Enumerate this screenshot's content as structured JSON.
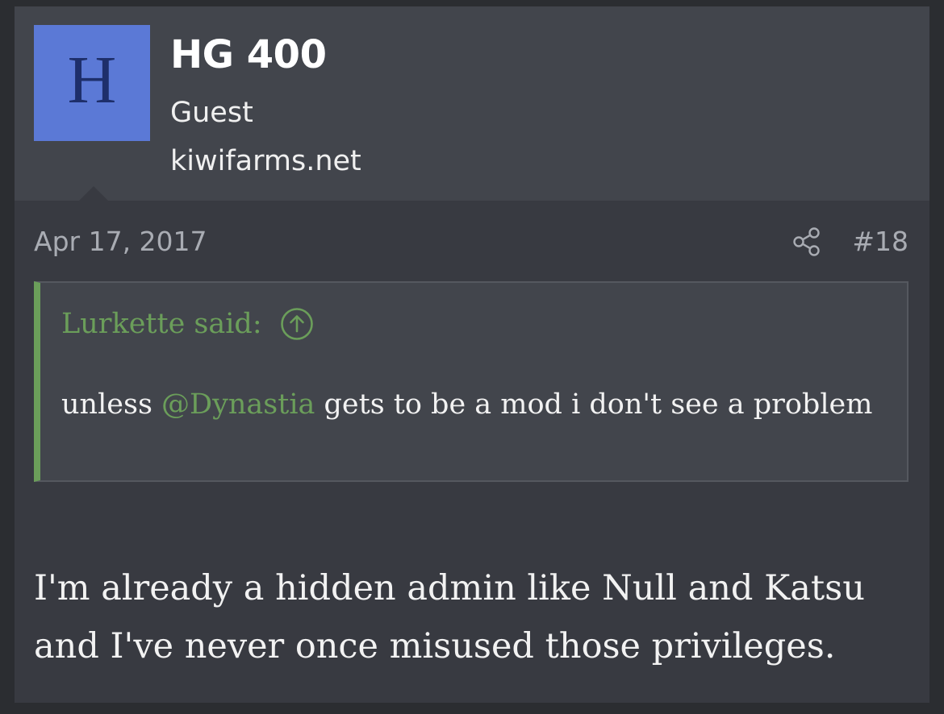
{
  "user": {
    "avatar_letter": "H",
    "name": "HG 400",
    "title": "Guest",
    "site": "kiwifarms.net"
  },
  "meta": {
    "date": "Apr 17, 2017",
    "share_icon": "share-icon",
    "post_number": "#18"
  },
  "quote": {
    "author_label": "Lurkette said:",
    "jump_icon": "arrow-up-circle-icon",
    "text_before": "unless ",
    "mention": "@Dynastia",
    "text_after": " gets to be a mod i don't see a problem"
  },
  "post": {
    "body": "I'm already a hidden admin like Null and Katsu and I've never once misused those privileges."
  },
  "colors": {
    "background": "#383a41",
    "header": "#42454c",
    "avatar": "#5b79d6",
    "quote_accent": "#6b9e5a",
    "muted_text": "#a9acb3"
  }
}
